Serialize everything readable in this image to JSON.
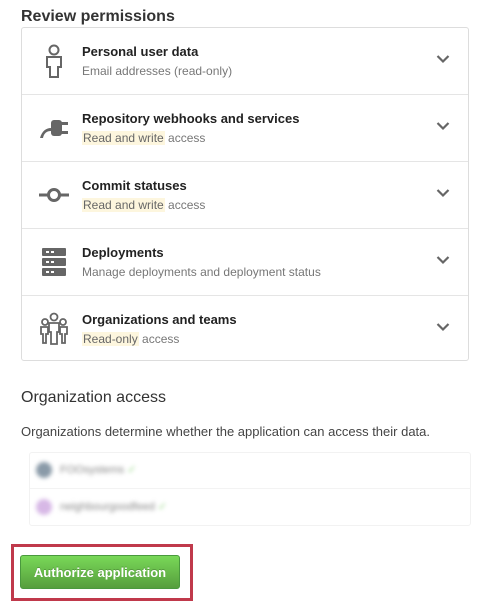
{
  "review_permissions": {
    "title": "Review permissions",
    "items": [
      {
        "name": "Personal user data",
        "desc": "Email addresses (read-only)",
        "icon": "person-icon"
      },
      {
        "name": "Repository webhooks and services",
        "desc_highlight": "Read and write",
        "desc_rest": " access",
        "icon": "plug-icon"
      },
      {
        "name": "Commit statuses",
        "desc_highlight": "Read and write",
        "desc_rest": " access",
        "icon": "commit-icon"
      },
      {
        "name": "Deployments",
        "desc": "Manage deployments and deployment status",
        "icon": "server-icon"
      },
      {
        "name": "Organizations and teams",
        "desc_highlight": "Read-only",
        "desc_rest": " access",
        "icon": "organization-icon"
      }
    ]
  },
  "organization_access": {
    "title": "Organization access",
    "description": "Organizations determine whether the application can access their data.",
    "orgs": [
      {
        "name": "FOOsystems",
        "check": "✓",
        "avatar_color": "#8a9aa8"
      },
      {
        "name": "neighbourgoodfeed",
        "check": "✓",
        "avatar_color": "#d7b8e6"
      }
    ]
  },
  "authorize_button": "Authorize application",
  "colors": {
    "accent_green": "#6cc644",
    "highlight_frame": "#c0394b",
    "highlight_text_bg": "#fdf6de"
  }
}
